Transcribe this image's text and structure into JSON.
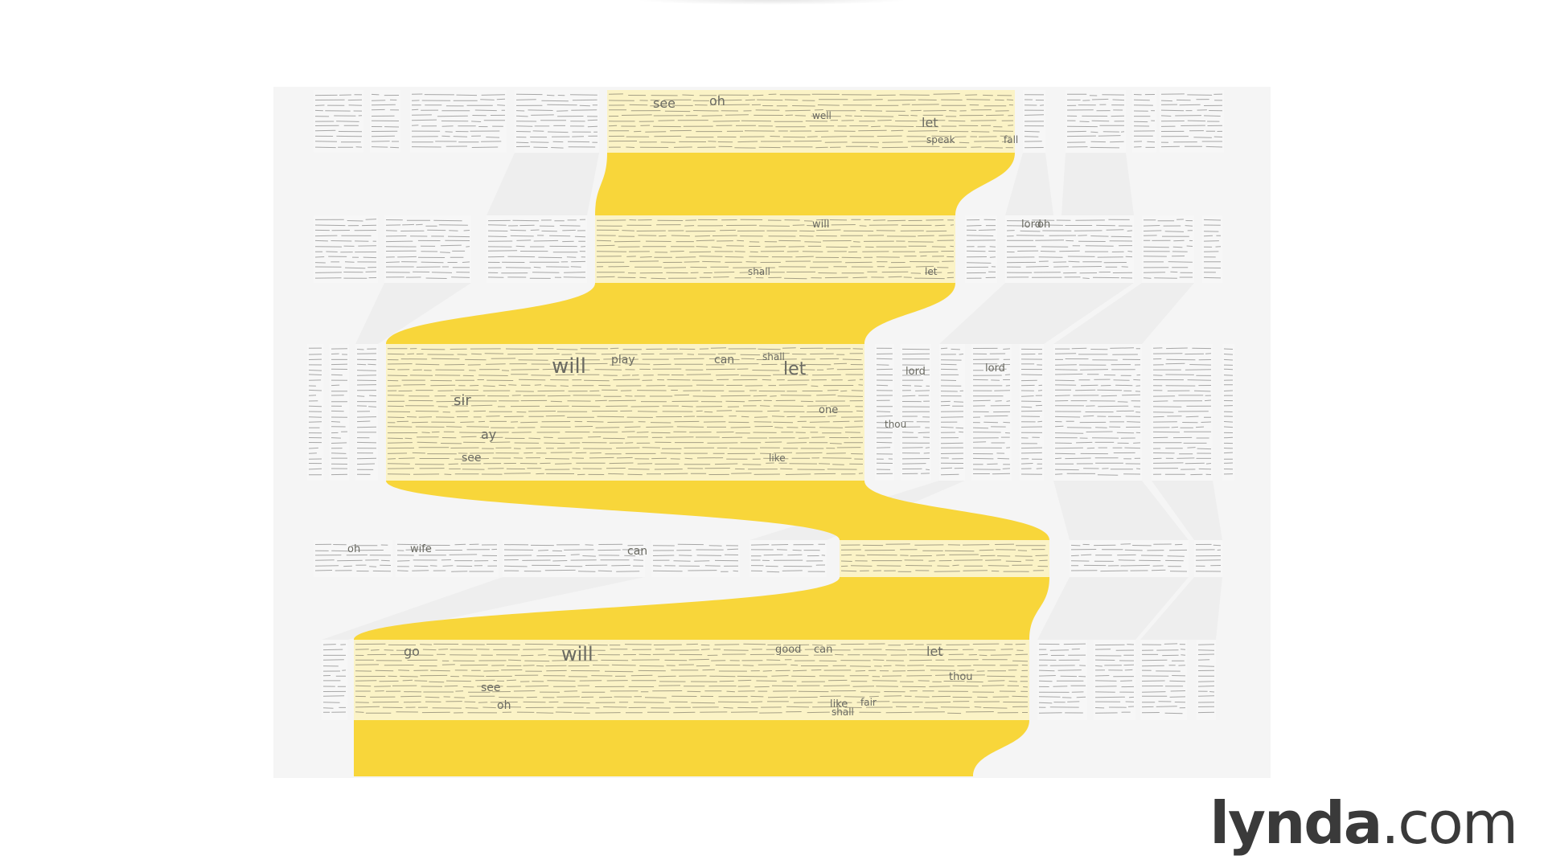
{
  "diagram": {
    "type": "storyline-word-flow",
    "colors": {
      "background": "#ffffff",
      "panel": "#f5f5f5",
      "highlight_band": "#fbf3c6",
      "highlight_flow": "#f8d63a",
      "text_lines": "#8c8c8c",
      "flow_gray": "#eeeeee"
    },
    "rows": [
      {
        "id": "row1",
        "words": [
          "see",
          "oh",
          "well",
          "let",
          "speak",
          "fall"
        ]
      },
      {
        "id": "row2",
        "words": [
          "lord",
          "oh",
          "will",
          "shall",
          "let"
        ]
      },
      {
        "id": "row3",
        "words": [
          "will",
          "play",
          "can",
          "shall",
          "let",
          "sir",
          "ay",
          "see",
          "lord",
          "lord",
          "thou",
          "like",
          "one"
        ]
      },
      {
        "id": "row4",
        "words": [
          "oh",
          "wife",
          "can"
        ]
      },
      {
        "id": "row5",
        "words": [
          "go",
          "will",
          "good",
          "can",
          "let",
          "see",
          "oh",
          "thou",
          "like",
          "fair",
          "shall"
        ]
      }
    ]
  },
  "logo": {
    "brand": "lynda",
    "tld": ".com"
  }
}
